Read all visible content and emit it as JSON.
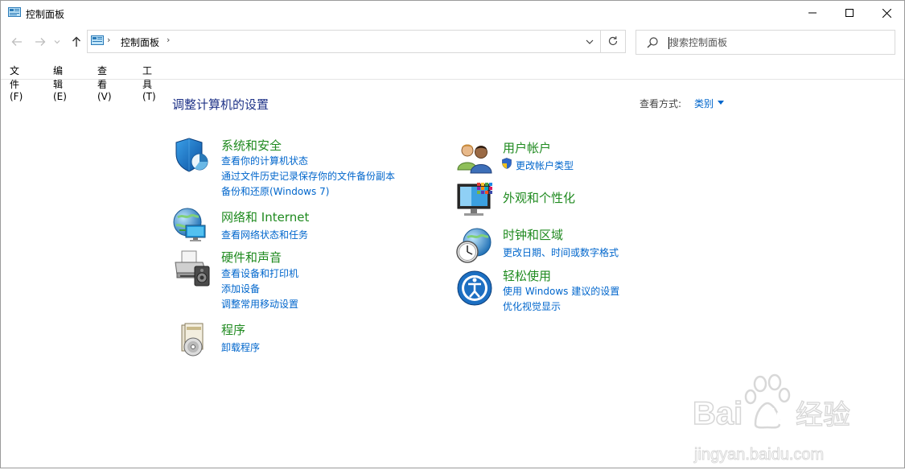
{
  "window": {
    "title": "控制面板"
  },
  "address": {
    "crumbs": [
      "控制面板"
    ],
    "search_placeholder": "搜索控制面板"
  },
  "menu": [
    "文件(F)",
    "编辑(E)",
    "查看(V)",
    "工具(T)"
  ],
  "main": {
    "heading": "调整计算机的设置",
    "view_by_label": "查看方式:",
    "view_by_value": "类别"
  },
  "categories_left": [
    {
      "title": "系统和安全",
      "icon": "shield-icon",
      "links": [
        "查看你的计算机状态",
        "通过文件历史记录保存你的文件备份副本",
        "备份和还原(Windows 7)"
      ]
    },
    {
      "title": "网络和 Internet",
      "icon": "network-icon",
      "links": [
        "查看网络状态和任务"
      ]
    },
    {
      "title": "硬件和声音",
      "icon": "printer-icon",
      "links": [
        "查看设备和打印机",
        "添加设备",
        "调整常用移动设置"
      ]
    },
    {
      "title": "程序",
      "icon": "programs-icon",
      "links": [
        "卸载程序"
      ]
    }
  ],
  "categories_right": [
    {
      "title": "用户帐户",
      "icon": "users-icon",
      "links": [
        "更改帐户类型"
      ]
    },
    {
      "title": "外观和个性化",
      "icon": "monitor-icon",
      "links": []
    },
    {
      "title": "时钟和区域",
      "icon": "clock-globe-icon",
      "links": [
        "更改日期、时间或数字格式"
      ]
    },
    {
      "title": "轻松使用",
      "icon": "ease-of-access-icon",
      "links": [
        "使用 Windows 建议的设置",
        "优化视觉显示"
      ]
    }
  ],
  "watermark": {
    "brand_a": "Bai",
    "brand_b": "du",
    "brand_c": "经验",
    "url": "jingyan.baidu.com"
  },
  "colors": {
    "link": "#0066cc",
    "category_title": "#1f8a1f",
    "heading": "#1e3287"
  }
}
